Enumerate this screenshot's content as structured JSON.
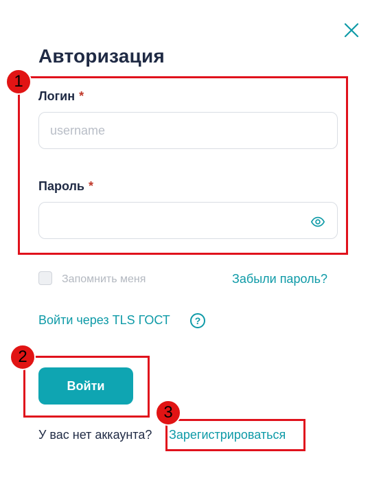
{
  "dialog": {
    "title": "Авторизация"
  },
  "login": {
    "label": "Логин",
    "required_mark": "*",
    "placeholder": "username",
    "value": ""
  },
  "password": {
    "label": "Пароль",
    "required_mark": "*",
    "value": "",
    "toggle_icon": "eye-icon"
  },
  "remember": {
    "label": "Запомнить меня",
    "checked": false
  },
  "links": {
    "forgot": "Забыли пароль?",
    "tls": "Войти через TLS ГОСТ",
    "help_glyph": "?"
  },
  "actions": {
    "submit_label": "Войти"
  },
  "register": {
    "prompt": "У вас нет аккаунта?",
    "link": "Зарегистрироваться"
  },
  "annotations": [
    "1",
    "2",
    "3"
  ],
  "colors": {
    "accent": "#0fa5b2",
    "link": "#0e9aa7",
    "heading": "#1f2a44",
    "highlight": "#e0121c",
    "required": "#c0392b"
  }
}
